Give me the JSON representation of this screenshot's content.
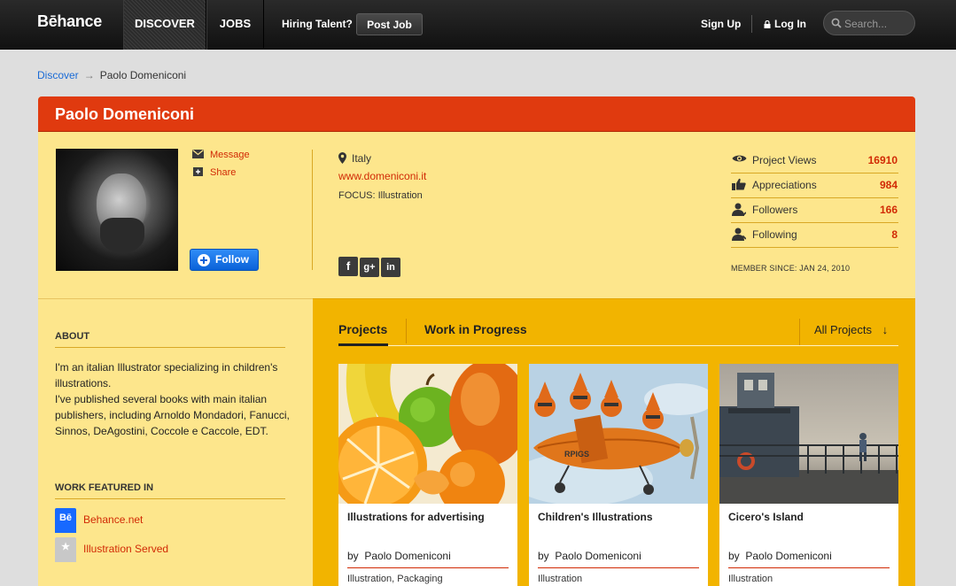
{
  "nav": {
    "logo": "Bēhance",
    "tabs": [
      "DISCOVER",
      "JOBS"
    ],
    "hiring_label": "Hiring Talent?",
    "post_job": "Post Job",
    "sign_up": "Sign Up",
    "log_in": "Log In",
    "search_placeholder": "Search..."
  },
  "breadcrumb": {
    "link": "Discover",
    "arrow": "→",
    "current": "Paolo Domeniconi"
  },
  "profile": {
    "name": "Paolo Domeniconi",
    "actions": {
      "message": "Message",
      "share": "Share"
    },
    "follow": "Follow",
    "location": "Italy",
    "website": "www.domeniconi.it",
    "focus": "FOCUS: Illustration",
    "socials": [
      {
        "icon": "facebook-icon",
        "glyph": "f"
      },
      {
        "icon": "google-plus-icon",
        "glyph": "g+"
      },
      {
        "icon": "linkedin-icon",
        "glyph": "in"
      }
    ],
    "stats": [
      {
        "icon": "eye-icon",
        "label": "Project Views",
        "value": "16910"
      },
      {
        "icon": "thumbs-up-icon",
        "label": "Appreciations",
        "value": "984"
      },
      {
        "icon": "followers-icon",
        "label": "Followers",
        "value": "166"
      },
      {
        "icon": "following-icon",
        "label": "Following",
        "value": "8"
      }
    ],
    "member_since": "MEMBER SINCE: JAN 24, 2010"
  },
  "about": {
    "title": "ABOUT",
    "text": "I'm an italian Illustrator specializing in children's illustrations.\nI've published several books with main italian publishers, including Arnoldo Mondadori, Fanucci, Sinnos, DeAgostini, Coccole e Caccole, EDT."
  },
  "featured": {
    "title": "WORK FEATURED IN",
    "items": [
      {
        "label": "Behance.net",
        "badge": "Bē",
        "color": "#1769ff"
      },
      {
        "label": "Illustration Served",
        "badge": "★",
        "color": "#c8c8c8"
      }
    ]
  },
  "work": {
    "tabs": [
      "Projects",
      "Work in Progress"
    ],
    "filter": "All Projects",
    "filter_arrow": "↓",
    "projects": [
      {
        "title": "Illustrations for advertising",
        "by_prefix": "by",
        "author": "Paolo Domeniconi",
        "tags": "Illustration, Packaging"
      },
      {
        "title": "Children's Illustrations",
        "by_prefix": "by",
        "author": "Paolo Domeniconi",
        "tags": "Illustration"
      },
      {
        "title": "Cicero's Island",
        "by_prefix": "by",
        "author": "Paolo Domeniconi",
        "tags": "Illustration"
      }
    ]
  },
  "colors": {
    "accent": "#e03a0f",
    "link": "#d12a05",
    "panel": "#fde68c",
    "work_bg": "#f2b400"
  }
}
